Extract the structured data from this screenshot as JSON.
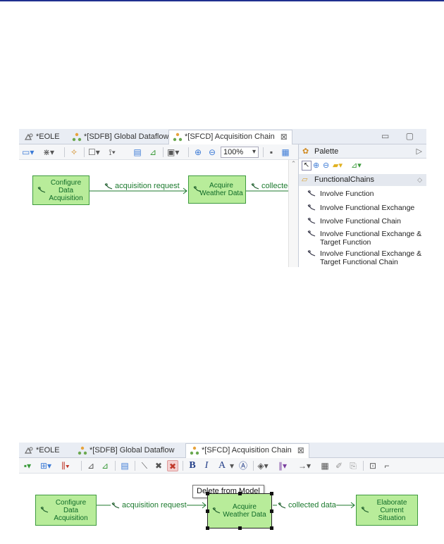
{
  "top": {
    "tabs": [
      {
        "label": "*EOLE",
        "icon": "project-icon"
      },
      {
        "label": "*[SDFB] Global Dataflow",
        "icon": "dataflow-diagram-icon"
      },
      {
        "label": "*[SFCD] Acquisition Chain",
        "icon": "functional-chain-diagram-icon",
        "close": "⊠"
      }
    ],
    "window_buttons": "▭ ▢",
    "zoom": "100%",
    "nodes": {
      "configure": "Configure Data Acquisition",
      "acquire": "Acquire Weather Data"
    },
    "edges": {
      "e1": "acquisition request",
      "e2": "collected"
    },
    "palette": {
      "title": "Palette",
      "drawer": "FunctionalChains",
      "items": [
        "Involve Function",
        "Involve Functional Exchange",
        "Involve Functional Chain",
        "Involve Functional Exchange & Target Function",
        "Involve Functional Exchange & Target Functional Chain"
      ]
    }
  },
  "bottom": {
    "tabs": [
      {
        "label": "*EOLE",
        "icon": "project-icon"
      },
      {
        "label": "*[SDFB] Global Dataflow",
        "icon": "dataflow-diagram-icon"
      },
      {
        "label": "*[SFCD] Acquisition Chain",
        "icon": "functional-chain-diagram-icon",
        "close": "⊠"
      }
    ],
    "tooltip": "Delete from Model",
    "toolbar_text": {
      "bold": "B",
      "italic": "I",
      "font": "A"
    },
    "nodes": {
      "configure": "Configure Data Acquisition",
      "acquire": "Acquire Weather Data",
      "elaborate": "Elaborate Current Situation"
    },
    "edges": {
      "e1": "acquisition request",
      "e2": "collected data"
    }
  },
  "colors": {
    "node_fill": "#b8ec9a",
    "node_border": "#3f9a3f",
    "edge": "#1c7a2e",
    "title_line": "#1f2f8f",
    "delete_highlight": "#f4d0d0"
  }
}
